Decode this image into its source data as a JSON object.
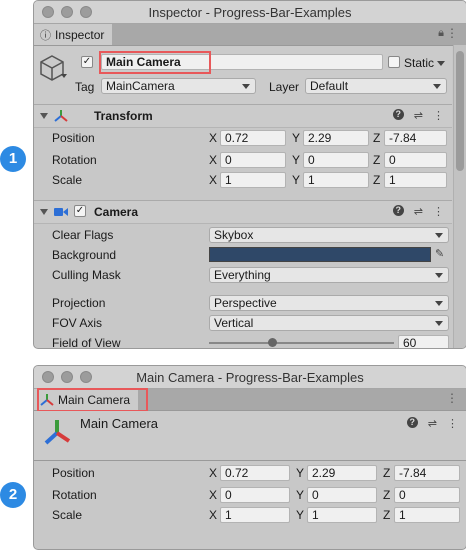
{
  "colors": {
    "badge": "#2d8ae3",
    "highlight": "#e8585a",
    "background_swatch": "#2f4868"
  },
  "badges": [
    "1",
    "2"
  ],
  "inspector": {
    "title": "Inspector - Progress-Bar-Examples",
    "tab_label": "Inspector",
    "object_name": "Main Camera",
    "static_label": "Static",
    "tag_label": "Tag",
    "tag_value": "MainCamera",
    "layer_label": "Layer",
    "layer_value": "Default",
    "transform": {
      "title": "Transform",
      "rows": [
        {
          "label": "Position",
          "x": "0.72",
          "y": "2.29",
          "z": "-7.84"
        },
        {
          "label": "Rotation",
          "x": "0",
          "y": "0",
          "z": "0"
        },
        {
          "label": "Scale",
          "x": "1",
          "y": "1",
          "z": "1"
        }
      ]
    },
    "camera": {
      "title": "Camera",
      "clear_flags_label": "Clear Flags",
      "clear_flags_value": "Skybox",
      "background_label": "Background",
      "culling_mask_label": "Culling Mask",
      "culling_mask_value": "Everything",
      "projection_label": "Projection",
      "projection_value": "Perspective",
      "fov_axis_label": "FOV Axis",
      "fov_axis_value": "Vertical",
      "fov_label": "Field of View",
      "fov_value": "60"
    }
  },
  "properties": {
    "title": "Main Camera - Progress-Bar-Examples",
    "tab_label": "Main Camera",
    "object_name": "Main Camera",
    "rows": [
      {
        "label": "Position",
        "x": "0.72",
        "y": "2.29",
        "z": "-7.84"
      },
      {
        "label": "Rotation",
        "x": "0",
        "y": "0",
        "z": "0"
      },
      {
        "label": "Scale",
        "x": "1",
        "y": "1",
        "z": "1"
      }
    ]
  },
  "axis_labels": {
    "x": "X",
    "y": "Y",
    "z": "Z"
  }
}
